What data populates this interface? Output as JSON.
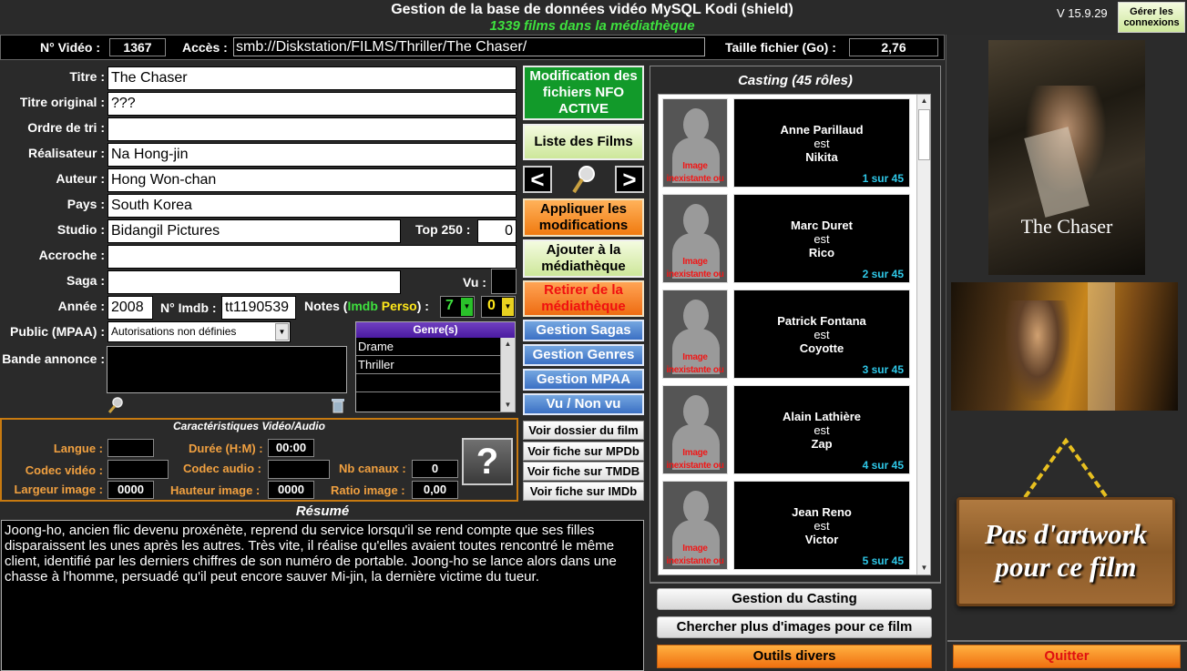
{
  "header": {
    "title": "Gestion de la base de données vidéo MySQL Kodi (shield)",
    "subtitle": "1339 films dans la médiathèque",
    "version": "V 15.9.29",
    "connections_button": "Gérer les connexions"
  },
  "topbar": {
    "video_no_label": "N° Vidéo :",
    "video_no": "1367",
    "access_label": "Accès :",
    "access_path": "smb://Diskstation/FILMS/Thriller/The Chaser/",
    "filesize_label": "Taille fichier (Go) :",
    "filesize": "2,76"
  },
  "form": {
    "title_label": "Titre :",
    "title": "The Chaser",
    "orig_label": "Titre original :",
    "orig": "???",
    "sort_label": "Ordre de tri :",
    "sort": "",
    "director_label": "Réalisateur :",
    "director": "Na Hong-jin",
    "author_label": "Auteur :",
    "author": "Hong Won-chan",
    "country_label": "Pays :",
    "country": "South Korea",
    "studio_label": "Studio :",
    "studio": "Bidangil Pictures",
    "top250_label": "Top 250 :",
    "top250": "0",
    "tagline_label": "Accroche :",
    "tagline": "",
    "saga_label": "Saga :",
    "saga": "",
    "seen_label": "Vu :",
    "year_label": "Année :",
    "year": "2008",
    "imdb_label": "N° Imdb :",
    "imdb": "tt1190539",
    "notes_label": "Notes (",
    "notes_imdb": "Imdb",
    "notes_perso": "Perso",
    "notes_close": ")",
    "note_imdb": "7",
    "note_perso": "0",
    "mpaa_label": "Public (MPAA) :",
    "mpaa": "Autorisations non définies",
    "trailer_label": "Bande annonce :",
    "genres_header": "Genre(s)",
    "genres": [
      "Drame",
      "Thriller",
      "",
      ""
    ]
  },
  "actions": {
    "nfo": "Modification des fichiers NFO ACTIVE",
    "list": "Liste des Films",
    "prev": "<",
    "next": ">",
    "apply": "Appliquer les modifications",
    "add": "Ajouter à la médiathèque",
    "remove": "Retirer de la médiathèque",
    "sagas": "Gestion Sagas",
    "genres": "Gestion Genres",
    "mpaa": "Gestion MPAA",
    "seen": "Vu / Non vu"
  },
  "tech": {
    "title": "Caractéristiques Vidéo/Audio",
    "lang_label": "Langue :",
    "lang": "",
    "duration_label": "Durée (H:M) :",
    "duration": "00:00",
    "vcodec_label": "Codec vidéo :",
    "vcodec": "",
    "acodec_label": "Codec audio :",
    "acodec": "",
    "channels_label": "Nb canaux :",
    "channels": "0",
    "width_label": "Largeur image :",
    "width": "0000",
    "height_label": "Hauteur image :",
    "height": "0000",
    "ratio_label": "Ratio image :",
    "ratio": "0,00",
    "help": "?"
  },
  "links": [
    "Voir dossier du film",
    "Voir fiche sur MPDb",
    "Voir fiche sur TMDB",
    "Voir fiche sur IMDb"
  ],
  "summary": {
    "title": "Résumé",
    "text": "Joong-ho, ancien flic devenu proxénète, reprend du service lorsqu'il se rend compte que ses filles disparaissent les unes après les autres. Très vite, il réalise qu'elles avaient toutes rencontré le même client, identifié par les derniers chiffres de son numéro de portable. Joong-ho se lance alors dans une chasse à l'homme, persuadé qu'il peut encore sauver Mi-jin, la dernière victime du tueur."
  },
  "casting": {
    "title": "Casting (45 rôles)",
    "no_image": "Image inexistante ou inaccessible",
    "est": "est",
    "items": [
      {
        "actor": "Anne Parillaud",
        "role": "Nikita",
        "pos": "1 sur 45"
      },
      {
        "actor": "Marc Duret",
        "role": "Rico",
        "pos": "2 sur 45"
      },
      {
        "actor": "Patrick Fontana",
        "role": "Coyotte",
        "pos": "3 sur 45"
      },
      {
        "actor": "Alain Lathière",
        "role": "Zap",
        "pos": "4 sur 45"
      },
      {
        "actor": "Jean Reno",
        "role": "Victor",
        "pos": "5 sur 45"
      }
    ],
    "manage": "Gestion du Casting",
    "more_images": "Chercher plus d'images pour ce film",
    "tools": "Outils divers"
  },
  "right": {
    "poster_title": "The Chaser",
    "artwork_line1": "Pas d'artwork",
    "artwork_line2": "pour ce film",
    "quit": "Quitter"
  }
}
